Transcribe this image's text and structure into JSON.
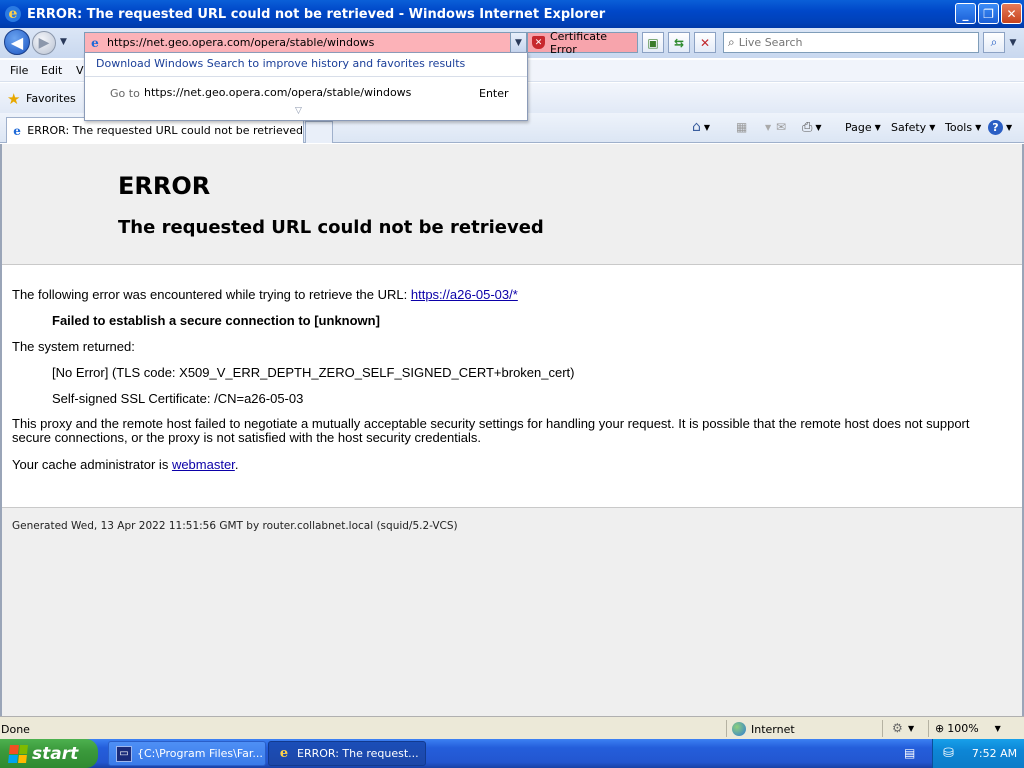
{
  "window": {
    "title": "ERROR: The requested URL could not be retrieved - Windows Internet Explorer",
    "buttons": {
      "minimize": "_",
      "maximize": "❐",
      "close": "✕"
    }
  },
  "nav": {
    "address": "https://net.geo.opera.com/opera/stable/windows",
    "cert_error": "Certificate Error",
    "search_placeholder": "Live Search"
  },
  "menu": {
    "items": [
      "File",
      "Edit",
      "Vi"
    ]
  },
  "favorites": {
    "label": "Favorites"
  },
  "autocomplete": {
    "windows_search_link": "Download Windows Search to improve history and favorites results",
    "go_to_label": "Go to",
    "go_to_url": "https://net.geo.opera.com/opera/stable/windows",
    "enter_label": "Enter"
  },
  "tab": {
    "title": "ERROR: The requested URL could not be retrieved"
  },
  "command_bar": {
    "page": "Page",
    "safety": "Safety",
    "tools": "Tools"
  },
  "page": {
    "heading": "ERROR",
    "subheading": "The requested URL could not be retrieved",
    "intro": "The following error was encountered while trying to retrieve the URL: ",
    "url_link": "https://a26-05-03/*",
    "failure": "Failed to establish a secure connection to [unknown]",
    "system_returned": "The system returned:",
    "tls_code": "[No Error] (TLS code: X509_V_ERR_DEPTH_ZERO_SELF_SIGNED_CERT+broken_cert)",
    "self_signed": "Self-signed SSL Certificate: /CN=a26-05-03",
    "explanation": "This proxy and the remote host failed to negotiate a mutually acceptable security settings for handling your request. It is possible that the remote host does not support secure connections, or the proxy is not satisfied with the host security credentials.",
    "admin_prefix": "Your cache administrator is ",
    "admin_link": "webmaster",
    "admin_suffix": ".",
    "generated": "Generated Wed, 13 Apr 2022 11:51:56 GMT by router.collabnet.local (squid/5.2-VCS)"
  },
  "status": {
    "text": "Done",
    "zone": "Internet",
    "zoom": "100%"
  },
  "taskbar": {
    "start": "start",
    "tasks": [
      "{C:\\Program Files\\Far...",
      "ERROR: The request..."
    ],
    "clock": "7:52 AM"
  },
  "colors": {
    "title_bar": "#0047c8",
    "cert_error_bg": "#f7a4ac",
    "link": "#0b00a8",
    "start_green": "#3b9a3c"
  }
}
